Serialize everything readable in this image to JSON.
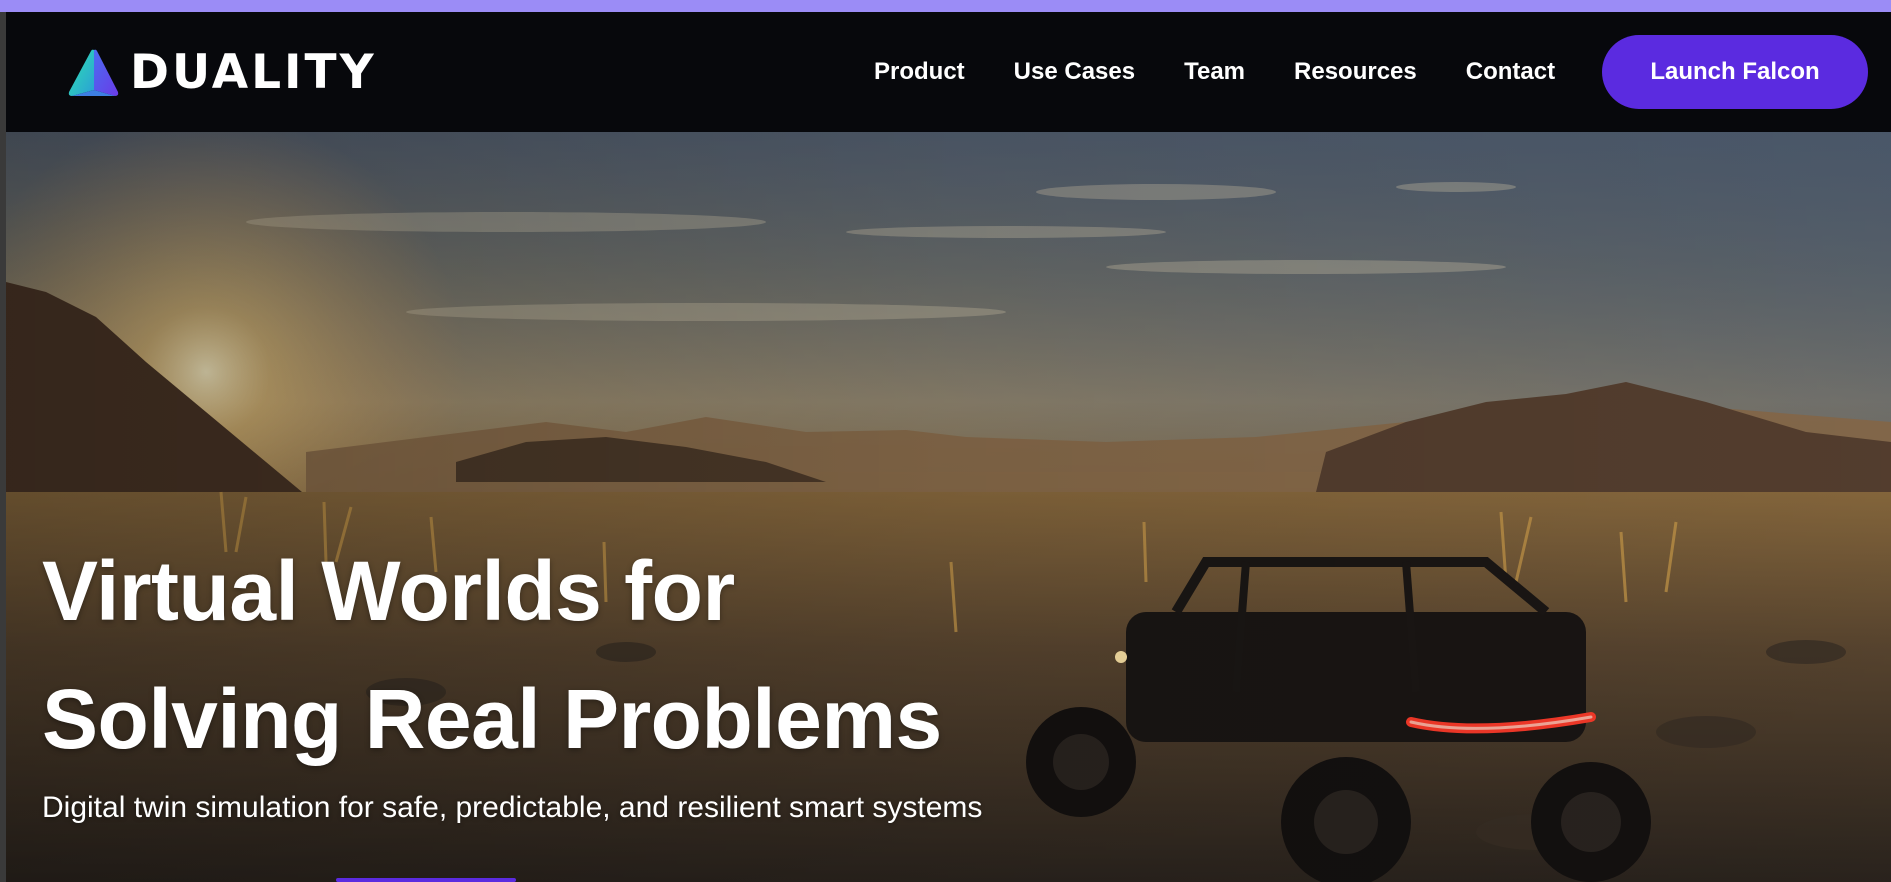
{
  "brand": {
    "name": "DUALITY",
    "logo_icon": "duality-prism-logo-icon",
    "colors": {
      "accent": "#5b2be0",
      "top_strip": "#9b8cf6",
      "nav_bg": "#07080c"
    }
  },
  "nav": {
    "items": [
      {
        "label": "Product"
      },
      {
        "label": "Use Cases"
      },
      {
        "label": "Team"
      },
      {
        "label": "Resources"
      },
      {
        "label": "Contact"
      }
    ],
    "cta_label": "Launch Falcon"
  },
  "hero": {
    "title_line1": "Virtual Worlds for",
    "title_line2": "Solving Real Problems",
    "subtitle": "Digital twin simulation for safe, predictable, and resilient smart systems",
    "background": "desert sunset with off-road vehicle"
  }
}
